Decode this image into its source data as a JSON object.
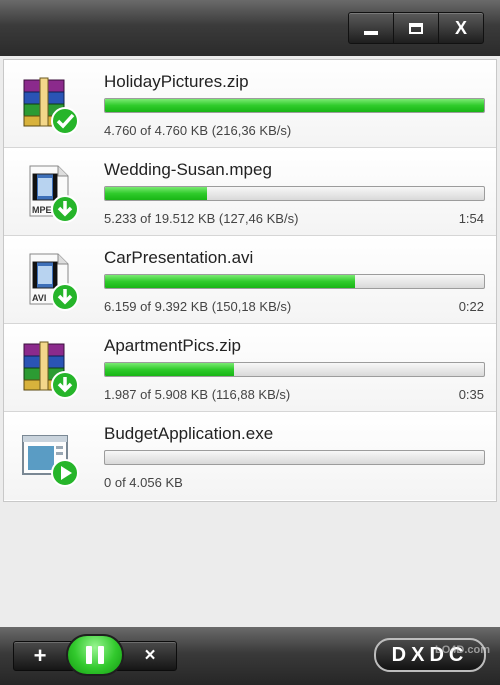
{
  "window": {
    "buttons": [
      {
        "name": "minimize",
        "icon": "minimize-icon"
      },
      {
        "name": "maximize",
        "icon": "maximize-icon"
      },
      {
        "name": "close",
        "label": "X",
        "icon": "close-icon"
      }
    ]
  },
  "downloads": [
    {
      "filename": "HolidayPictures.zip",
      "progress": 1.0,
      "stats": "4.760 of 4.760 KB (216,36 KB/s)",
      "eta": "",
      "icon": "archive-icon",
      "badge": "check-icon"
    },
    {
      "filename": "Wedding-Susan.mpeg",
      "progress": 0.27,
      "stats": "5.233 of 19.512 KB (127,46 KB/s)",
      "eta": "1:54",
      "icon": "video-file-icon",
      "badge": "download-arrow-icon",
      "file_label": "MPE"
    },
    {
      "filename": "CarPresentation.avi",
      "progress": 0.66,
      "stats": "6.159 of 9.392 KB (150,18 KB/s)",
      "eta": "0:22",
      "icon": "video-file-icon",
      "badge": "download-arrow-icon",
      "file_label": "AVI"
    },
    {
      "filename": "ApartmentPics.zip",
      "progress": 0.34,
      "stats": "1.987 of 5.908 KB (116,88 KB/s)",
      "eta": "0:35",
      "icon": "archive-icon",
      "badge": "download-arrow-icon"
    },
    {
      "filename": "BudgetApplication.exe",
      "progress": 0.0,
      "stats": "0 of 4.056 KB",
      "eta": "",
      "icon": "application-window-icon",
      "badge": "play-icon"
    }
  ],
  "toolbar": {
    "add_label": "+",
    "remove_label": "×",
    "pause_icon": "pause-icon"
  },
  "logo": {
    "text": "DXDC"
  },
  "watermark": {
    "text": "LO4D.com"
  },
  "colors": {
    "progress_green": "#2fcb2b",
    "chrome_dark": "#2b2b2b"
  }
}
